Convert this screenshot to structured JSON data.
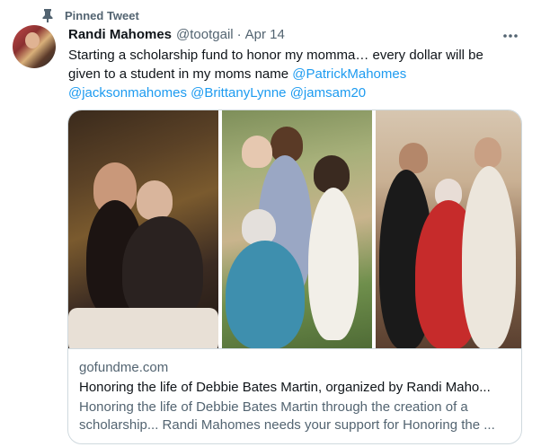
{
  "pinned": {
    "label": "Pinned Tweet",
    "icon": "pin-icon"
  },
  "author": {
    "display_name": "Randi Mahomes",
    "handle": "@tootgail",
    "separator": "·",
    "date": "Apr 14"
  },
  "more_button": {
    "label": "···",
    "icon": "more-horizontal-icon"
  },
  "tweet": {
    "text_before_mentions": "Starting a scholarship fund to honor my momma… every dollar will be given to a student in my moms name",
    "mentions": [
      "@PatrickMahomes",
      "@jacksonmahomes",
      "@BrittanyLynne",
      "@jamsam20"
    ]
  },
  "link_card": {
    "domain": "gofundme.com",
    "title": "Honoring the life of Debbie Bates Martin, organized by Randi Maho...",
    "description_line1": "Honoring the life of Debbie Bates Martin through the creation of a",
    "description_line2": "scholarship... Randi Mahomes needs your support for Honoring the ..."
  },
  "colors": {
    "link_blue": "#1d9bf0",
    "text_primary": "#0f1419",
    "text_secondary": "#536471",
    "border": "#cfd9de"
  }
}
